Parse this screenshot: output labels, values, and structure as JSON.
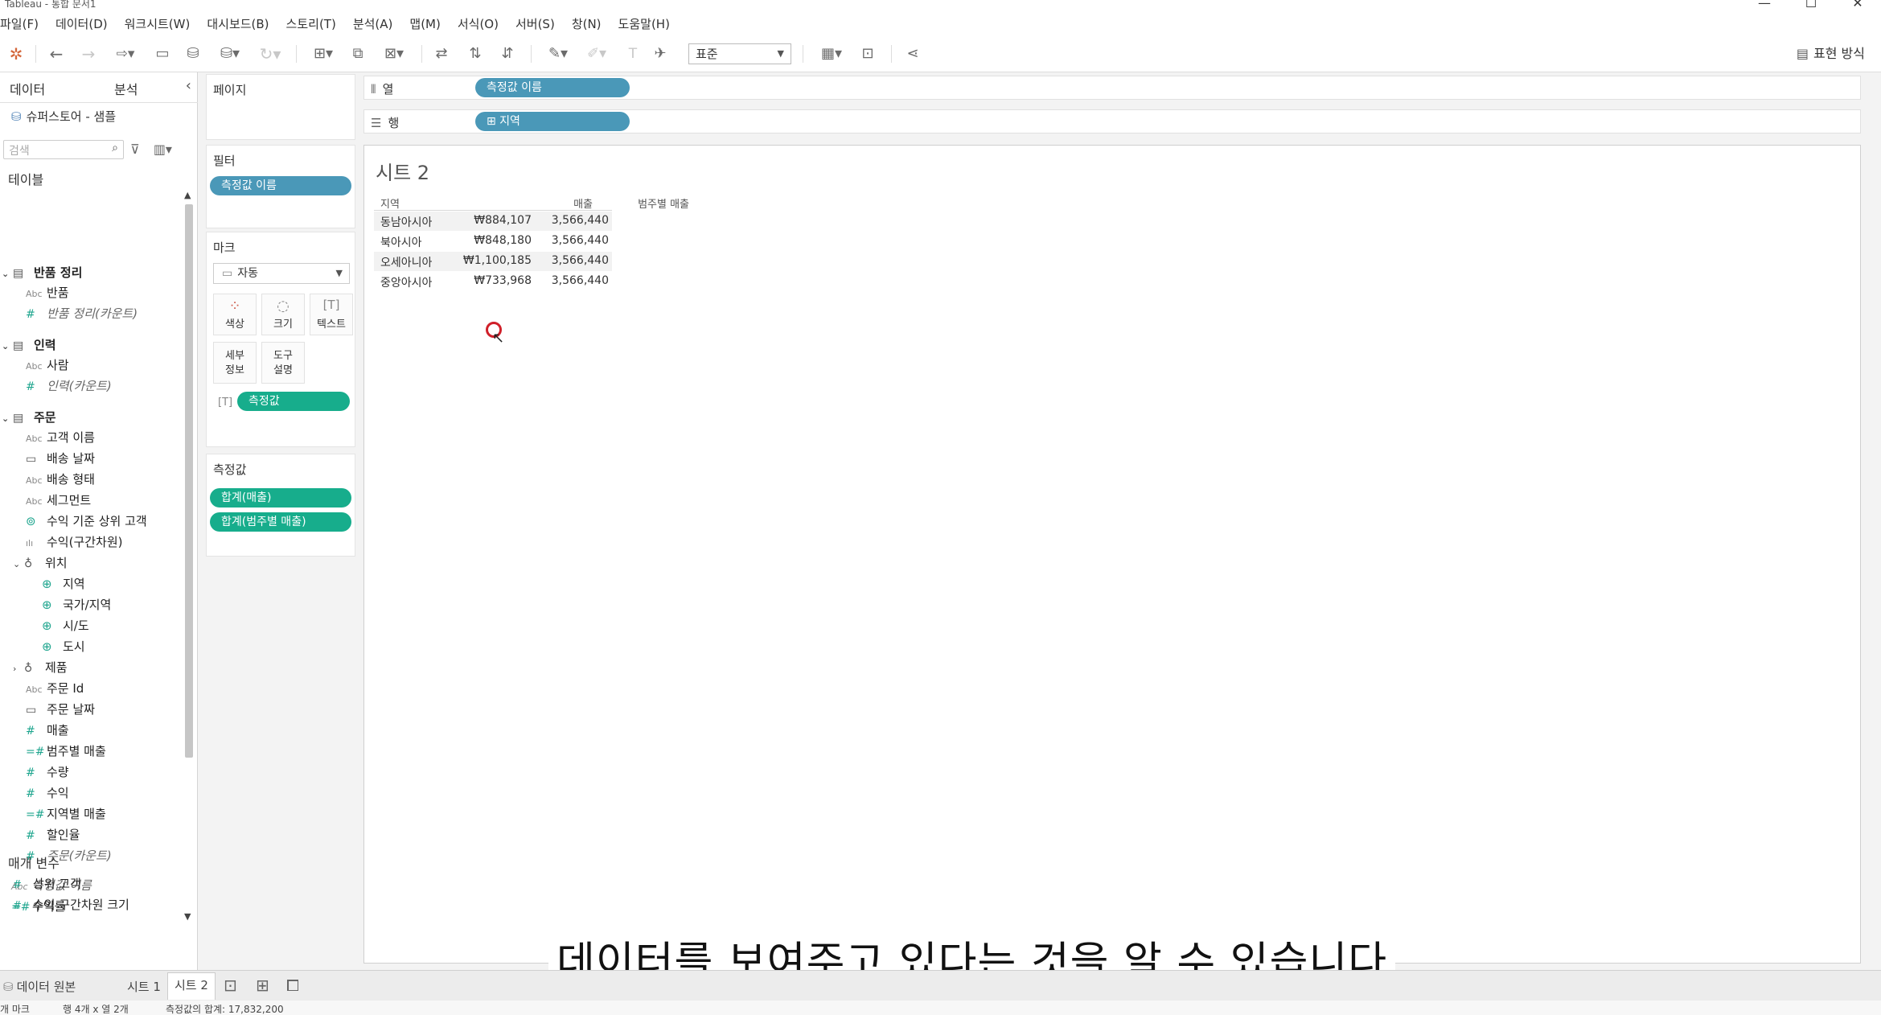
{
  "window": {
    "title": "Tableau - 통합 문서1",
    "controls": [
      "—",
      "☐",
      "✕"
    ]
  },
  "menu": [
    "파일(F)",
    "데이터(D)",
    "워크시트(W)",
    "대시보드(B)",
    "스토리(T)",
    "분석(A)",
    "맵(M)",
    "서식(O)",
    "서버(S)",
    "창(N)",
    "도움말(H)"
  ],
  "toolbar": {
    "fit_value": "표준",
    "show_me_label": "표현 방식",
    "icons": [
      "tableau-logo-icon",
      "undo-icon",
      "redo-icon",
      "redo-dropdown-icon",
      "save-icon",
      "new-datasource-icon",
      "pause-update-icon",
      "refresh-icon",
      "new-worksheet-icon",
      "duplicate-sheet-icon",
      "clear-sheet-icon",
      "swap-icon",
      "sort-ascending-icon",
      "sort-descending-icon",
      "highlight-icon",
      "group-icon",
      "label-icon",
      "pin-icon",
      "view-cards-icon",
      "presentation-icon",
      "share-icon"
    ]
  },
  "left_pane": {
    "tab_data": "데이터",
    "tab_analysis": "분석",
    "datasource": "슈퍼스토어 - 샘플",
    "search_placeholder": "검색",
    "tables_heading": "테이블",
    "fields": [
      {
        "label": "반품 정리",
        "type": "table",
        "bold": true,
        "caret": "⌄"
      },
      {
        "label": "반품",
        "type": "Abc"
      },
      {
        "label": "반품 정리(카운트)",
        "type": "#",
        "italic": true
      },
      {
        "label": "인력",
        "type": "table",
        "bold": true,
        "caret": "⌄"
      },
      {
        "label": "사람",
        "type": "Abc"
      },
      {
        "label": "인력(카운트)",
        "type": "#",
        "italic": true
      },
      {
        "label": "주문",
        "type": "table",
        "bold": true,
        "caret": "⌄"
      },
      {
        "label": "고객 이름",
        "type": "Abc"
      },
      {
        "label": "배송 날짜",
        "type": "date"
      },
      {
        "label": "배송 형태",
        "type": "Abc"
      },
      {
        "label": "세그먼트",
        "type": "Abc"
      },
      {
        "label": "수익 기준 상위 고객",
        "type": "set"
      },
      {
        "label": "수익(구간차원)",
        "type": "bin"
      },
      {
        "label": "위치",
        "type": "hier",
        "caret": "⌄"
      },
      {
        "label": "지역",
        "type": "geo",
        "indent": 2
      },
      {
        "label": "국가/지역",
        "type": "geo",
        "indent": 2
      },
      {
        "label": "시/도",
        "type": "geo",
        "indent": 2
      },
      {
        "label": "도시",
        "type": "geo",
        "indent": 2
      },
      {
        "label": "제품",
        "type": "hier",
        "caret": "›"
      },
      {
        "label": "주문 Id",
        "type": "Abc"
      },
      {
        "label": "주문 날짜",
        "type": "date"
      },
      {
        "label": "매출",
        "type": "#"
      },
      {
        "label": "범주별 매출",
        "type": "=#"
      },
      {
        "label": "수량",
        "type": "#"
      },
      {
        "label": "수익",
        "type": "#"
      },
      {
        "label": "지역별 매출",
        "type": "=#"
      },
      {
        "label": "할인율",
        "type": "#"
      },
      {
        "label": "주문(카운트)",
        "type": "#",
        "italic": true
      },
      {
        "label": "측정값 이름",
        "type": "Abc",
        "italic": true,
        "outdent": true
      },
      {
        "label": "수익률",
        "type": "=#",
        "outdent": true
      }
    ],
    "params_heading": "매개 변수",
    "params": [
      {
        "label": "상위 고객",
        "type": "#"
      },
      {
        "label": "수익 구간차원 크기",
        "type": "#"
      }
    ]
  },
  "pages_card": {
    "title": "페이지"
  },
  "filters_card": {
    "title": "필터",
    "pill": "측정값 이름"
  },
  "marks_card": {
    "title": "마크",
    "mark_type": "자동",
    "buttons": [
      {
        "label": "색상",
        "icon": "color-icon"
      },
      {
        "label": "크기",
        "icon": "size-icon"
      },
      {
        "label": "텍스트",
        "icon": "text-icon"
      },
      {
        "label": "세부\n정보",
        "icon": ""
      },
      {
        "label": "도구\n설명",
        "icon": ""
      }
    ],
    "text_pill": "측정값"
  },
  "measure_values_card": {
    "title": "측정값",
    "pills": [
      "합계(매출)",
      "합계(범주별 매출)"
    ]
  },
  "columns_shelf": {
    "label": "열",
    "pill": "측정값 이름"
  },
  "rows_shelf": {
    "label": "행",
    "pill": "⊞ 지역"
  },
  "view": {
    "sheet_title": "시트 2",
    "headers": [
      "지역",
      "매출",
      "범주별 매출"
    ],
    "rows": [
      [
        "동남아시아",
        "₩884,107",
        "3,566,440"
      ],
      [
        "북아시아",
        "₩848,180",
        "3,566,440"
      ],
      [
        "오세아니아",
        "₩1,100,185",
        "3,566,440"
      ],
      [
        "중앙아시아",
        "₩733,968",
        "3,566,440"
      ]
    ]
  },
  "subtitle": "데이터를 보여주고 있다는 것을 알 수 있습니다",
  "bottom_tabs": {
    "datasource": "데이터 원본",
    "sheets": [
      "시트 1",
      "시트 2"
    ]
  },
  "status": {
    "marks": "개 마크",
    "dims": "행 4개 x 열 2개",
    "sum": "측정값의 합계: 17,832,200"
  }
}
